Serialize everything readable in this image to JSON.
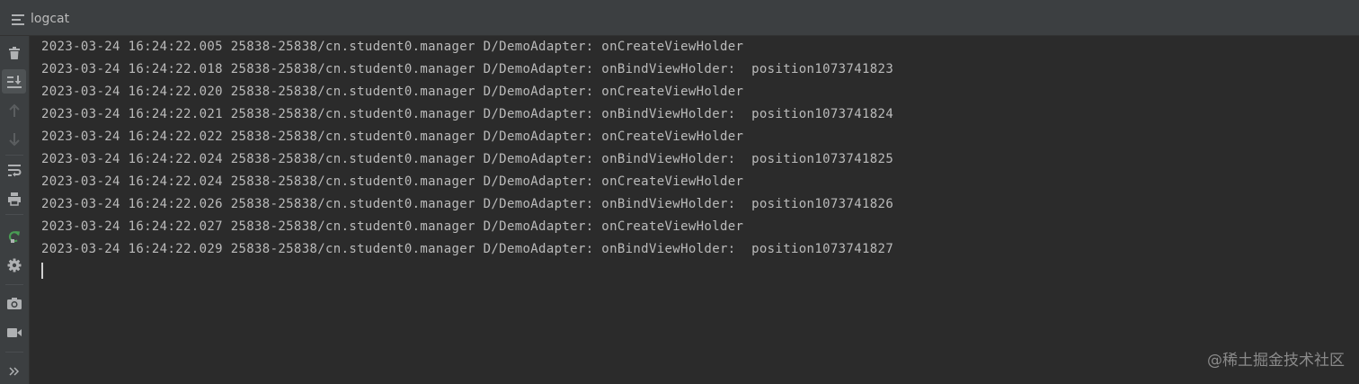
{
  "header": {
    "icon": "menu-lines-icon",
    "title": "logcat"
  },
  "sidebar": {
    "tools": [
      {
        "name": "clear-logcat",
        "icon": "trash-icon"
      },
      {
        "name": "scroll-to-end",
        "icon": "scroll-to-end-icon",
        "active": true
      },
      {
        "name": "up-stack-trace",
        "icon": "arrow-up-icon",
        "disabled": true
      },
      {
        "name": "down-stack-trace",
        "icon": "arrow-down-icon",
        "disabled": true
      },
      {
        "name": "soft-wraps",
        "icon": "soft-wrap-icon"
      },
      {
        "name": "print",
        "icon": "printer-icon"
      },
      {
        "name": "restart-logcat",
        "icon": "restart-icon"
      },
      {
        "name": "settings",
        "icon": "gear-icon"
      },
      {
        "name": "screen-capture",
        "icon": "camera-icon"
      },
      {
        "name": "screen-record",
        "icon": "video-camera-icon"
      },
      {
        "name": "more",
        "icon": "double-chevron-right-icon"
      }
    ]
  },
  "log": {
    "lines": [
      "2023-03-24 16:24:22.005 25838-25838/cn.student0.manager D/DemoAdapter: onCreateViewHolder",
      "2023-03-24 16:24:22.018 25838-25838/cn.student0.manager D/DemoAdapter: onBindViewHolder:  position1073741823",
      "2023-03-24 16:24:22.020 25838-25838/cn.student0.manager D/DemoAdapter: onCreateViewHolder",
      "2023-03-24 16:24:22.021 25838-25838/cn.student0.manager D/DemoAdapter: onBindViewHolder:  position1073741824",
      "2023-03-24 16:24:22.022 25838-25838/cn.student0.manager D/DemoAdapter: onCreateViewHolder",
      "2023-03-24 16:24:22.024 25838-25838/cn.student0.manager D/DemoAdapter: onBindViewHolder:  position1073741825",
      "2023-03-24 16:24:22.024 25838-25838/cn.student0.manager D/DemoAdapter: onCreateViewHolder",
      "2023-03-24 16:24:22.026 25838-25838/cn.student0.manager D/DemoAdapter: onBindViewHolder:  position1073741826",
      "2023-03-24 16:24:22.027 25838-25838/cn.student0.manager D/DemoAdapter: onCreateViewHolder",
      "2023-03-24 16:24:22.029 25838-25838/cn.student0.manager D/DemoAdapter: onBindViewHolder:  position1073741827"
    ]
  },
  "watermark": "@稀土掘金技术社区",
  "colors": {
    "background": "#2b2b2b",
    "toolbar": "#3c3f41",
    "text": "#bbbbbb",
    "icon": "#afb1b3",
    "icon_disabled": "#5b5e60",
    "restart_green": "#499c54"
  }
}
